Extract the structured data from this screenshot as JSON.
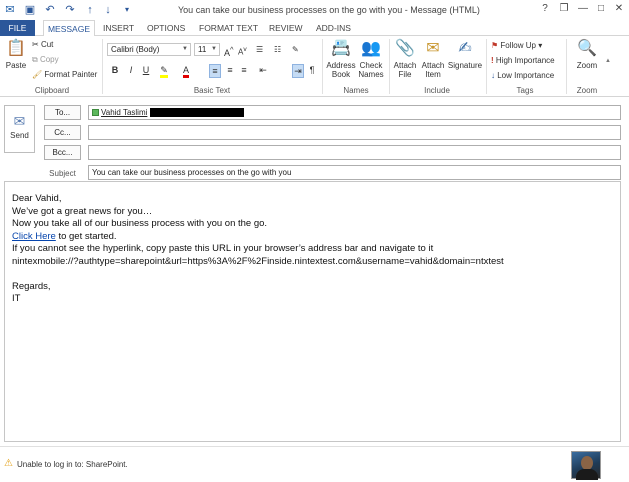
{
  "window": {
    "title": "You can take our business processes on the go with you - Message (HTML)",
    "controls": {
      "help": "?",
      "restore": "❐",
      "minimize": "—",
      "maximize": "□",
      "close": "✕"
    }
  },
  "quick_access": {
    "icons": [
      "outlook-icon",
      "save-icon",
      "undo-icon",
      "redo-icon",
      "up-icon",
      "down-icon",
      "customize-icon"
    ]
  },
  "tabs": [
    {
      "label": "FILE"
    },
    {
      "label": "MESSAGE"
    },
    {
      "label": "INSERT"
    },
    {
      "label": "OPTIONS"
    },
    {
      "label": "FORMAT TEXT"
    },
    {
      "label": "REVIEW"
    },
    {
      "label": "ADD-INS"
    }
  ],
  "ribbon": {
    "clipboard": {
      "label": "Clipboard",
      "paste": "Paste",
      "cut": "Cut",
      "copy": "Copy",
      "format_painter": "Format Painter"
    },
    "basic_text": {
      "label": "Basic Text",
      "font": "Calibri (Body)",
      "size": "11",
      "bold": "B",
      "italic": "I",
      "underline": "U"
    },
    "names": {
      "label": "Names",
      "address_book": "Address Book",
      "check_names": "Check Names"
    },
    "include": {
      "label": "Include",
      "attach_file": "Attach File",
      "attach_item": "Attach Item",
      "signature": "Signature"
    },
    "tags": {
      "label": "Tags",
      "follow_up": "Follow Up",
      "high_importance": "High Importance",
      "low_importance": "Low Importance"
    },
    "zoom": {
      "label": "Zoom",
      "zoom": "Zoom"
    }
  },
  "header": {
    "send": "Send",
    "to_label": "To...",
    "cc_label": "Cc...",
    "bcc_label": "Bcc...",
    "subject_label": "Subject",
    "to_value": "Vahid Taslimi",
    "cc_value": "",
    "bcc_value": "",
    "subject_value": "You can take our business processes on the go with you"
  },
  "body": {
    "greeting": "Dear Vahid,",
    "line1": "We’ve got a great news for you…",
    "line2": "Now you take all of our business process with you on the go.",
    "link_text": "Click Here",
    "link_after": " to get started.",
    "line4": "If you cannot see the hyperlink, copy paste this URL in your browser’s address bar and navigate to it",
    "line5": "nintexmobile://?authtype=sharepoint&url=https%3A%2F%2Finside.nintextest.com&username=vahid&domain=ntxtest",
    "regards": "Regards,",
    "signature": "IT"
  },
  "status": {
    "text": "Unable to log in to: SharePoint.",
    "warning_color": "#e3a21a"
  },
  "colors": {
    "accent": "#2b579a",
    "link": "#0645ad"
  }
}
